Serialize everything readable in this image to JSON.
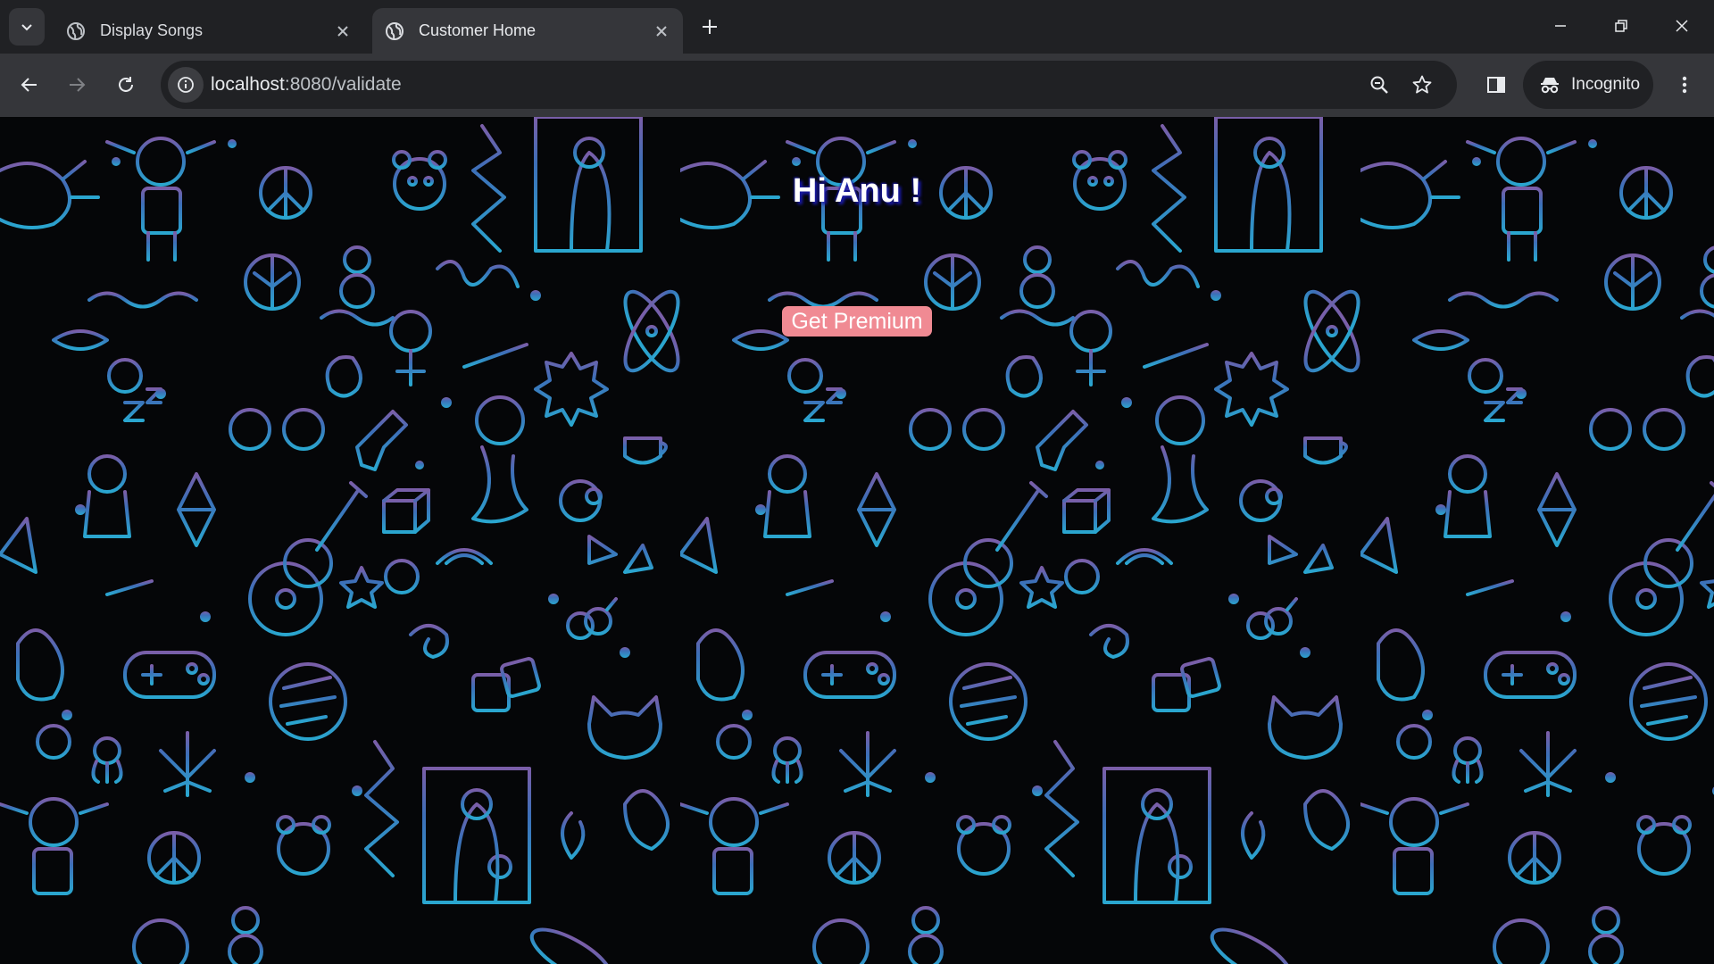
{
  "browser": {
    "tabs": [
      {
        "title": "Display Songs",
        "active": false,
        "icon": "globe-icon"
      },
      {
        "title": "Customer Home",
        "active": true,
        "icon": "globe-icon"
      }
    ],
    "address": {
      "host": "localhost",
      "rest": ":8080/validate"
    },
    "profile_label": "Incognito"
  },
  "page": {
    "greeting": "Hi Anu !",
    "premium_button": "Get Premium"
  },
  "colors": {
    "accent_button": "#f08a93",
    "greeting_shadow": "#1a1aa8",
    "pattern_blue": "#2a8fc0",
    "pattern_purple": "#7a5ea8"
  }
}
